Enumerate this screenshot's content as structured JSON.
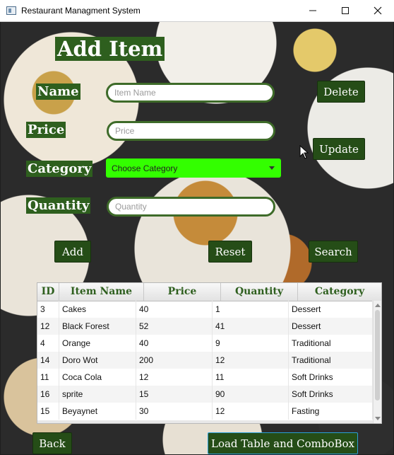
{
  "window": {
    "title": "Restaurant Managment System",
    "controls": [
      "minimize",
      "maximize",
      "close"
    ]
  },
  "form": {
    "heading": "Add Item",
    "name_label": "Name",
    "name_placeholder": "Item Name",
    "price_label": "Price",
    "price_placeholder": "Price",
    "category_label": "Category",
    "category_placeholder": "Choose Category",
    "quantity_label": "Quantity",
    "quantity_placeholder": "Quantity"
  },
  "buttons": {
    "delete": "Delete",
    "update": "Update",
    "add": "Add",
    "reset": "Reset",
    "search": "Search",
    "back": "Back",
    "load": "Load Table and ComboBox"
  },
  "table": {
    "columns": [
      "ID",
      "Item Name",
      "Price",
      "Quantity",
      "Category"
    ],
    "rows": [
      [
        "3",
        "Cakes",
        "40",
        "1",
        "Dessert"
      ],
      [
        "12",
        "Black Forest",
        "52",
        "41",
        "Dessert"
      ],
      [
        "4",
        "Orange",
        "40",
        "9",
        "Traditional"
      ],
      [
        "14",
        "Doro Wot",
        "200",
        "12",
        "Traditional"
      ],
      [
        "11",
        "Coca Cola",
        "12",
        "11",
        "Soft Drinks"
      ],
      [
        "16",
        "sprite",
        "15",
        "90",
        "Soft Drinks"
      ],
      [
        "15",
        "Beyaynet",
        "30",
        "12",
        "Fasting"
      ]
    ]
  },
  "colors": {
    "accent_green": "#2e5f1e",
    "combo_green": "#33ff00",
    "button_green": "#254d17"
  }
}
